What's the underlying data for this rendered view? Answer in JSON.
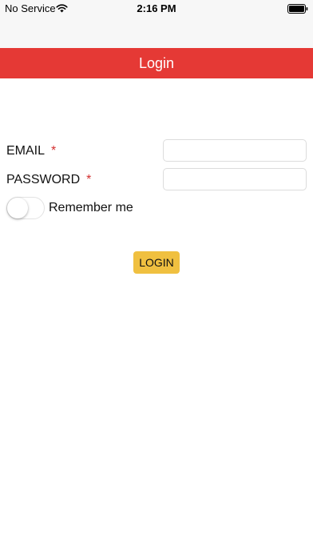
{
  "status_bar": {
    "carrier": "No Service",
    "time": "2:16 PM",
    "wifi_icon": "wifi-icon",
    "battery_icon": "battery-icon"
  },
  "header": {
    "title": "Login",
    "color": "#e53935"
  },
  "form": {
    "email_label": "EMAIL",
    "email_required": "*",
    "email_value": "",
    "password_label": "PASSWORD",
    "password_required": "*",
    "password_value": "",
    "remember_label": "Remember me",
    "remember_on": false,
    "login_label": "LOGIN",
    "login_color": "#f0c040"
  }
}
